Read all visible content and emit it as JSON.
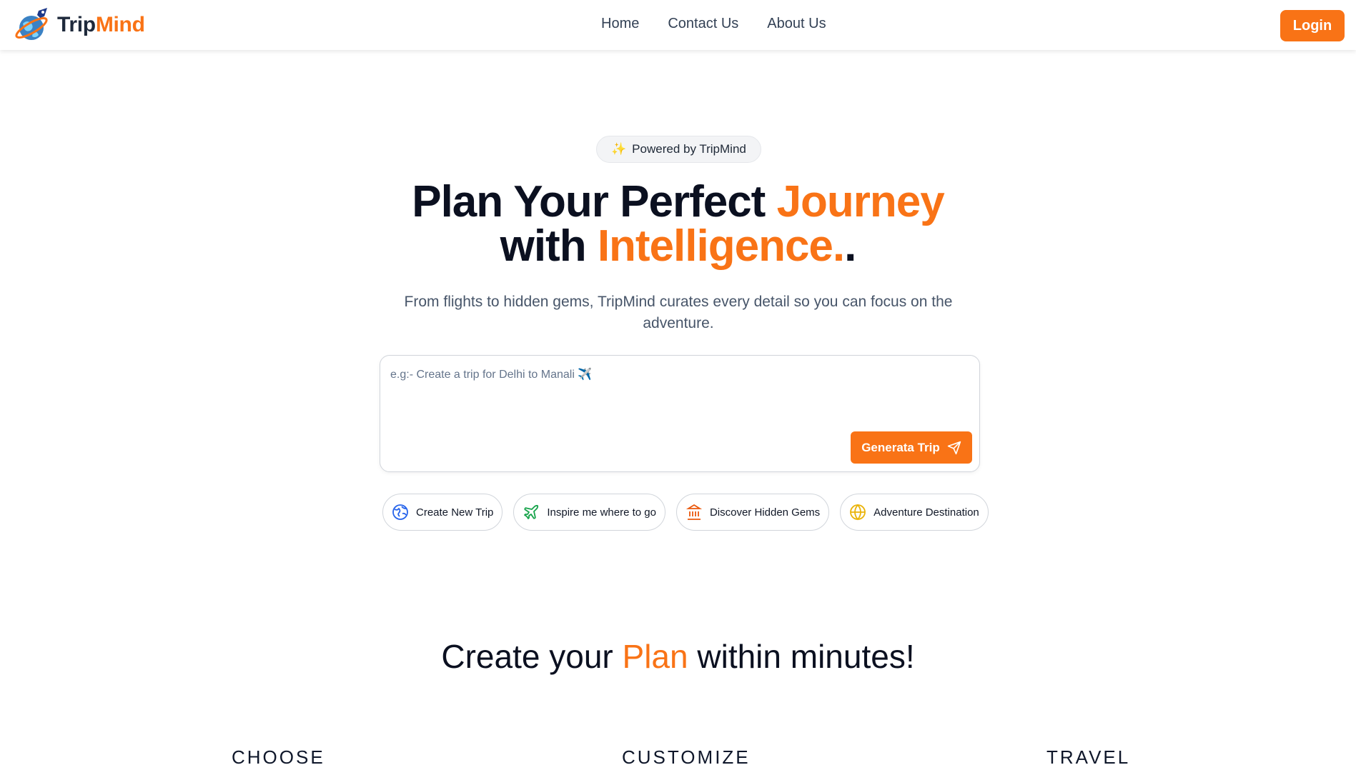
{
  "header": {
    "logo_part1": "Trip",
    "logo_part2": "Mind",
    "nav": [
      "Home",
      "Contact Us",
      "About Us"
    ],
    "login_label": "Login"
  },
  "hero": {
    "badge": "Powered by TripMind",
    "title_line1_a": "Plan Your Perfect ",
    "title_line1_b": "Journey",
    "title_line2_a": "with ",
    "title_line2_b": "Intelligence.",
    "title_line2_c": ".",
    "subtitle": "From flights to hidden gems, TripMind curates every detail so you can focus on the adventure.",
    "input_placeholder": "e.g:- Create a trip for Delhi to Manali ✈️",
    "generate_label": "Generata Trip"
  },
  "chips": [
    {
      "label": "Create New Trip",
      "icon": "globe-icon",
      "color": "#2563eb"
    },
    {
      "label": "Inspire me where to go",
      "icon": "plane-icon",
      "color": "#16a34a"
    },
    {
      "label": "Discover Hidden Gems",
      "icon": "landmark-icon",
      "color": "#ea580c"
    },
    {
      "label": "Adventure Destination",
      "icon": "globe-alt-icon",
      "color": "#eab308"
    }
  ],
  "section": {
    "title_a": "Create your ",
    "title_b": "Plan",
    "title_c": " within minutes!"
  },
  "steps": [
    "CHOOSE",
    "CUSTOMIZE",
    "TRAVEL"
  ],
  "colors": {
    "accent": "#f97316",
    "text": "#0b1020"
  }
}
